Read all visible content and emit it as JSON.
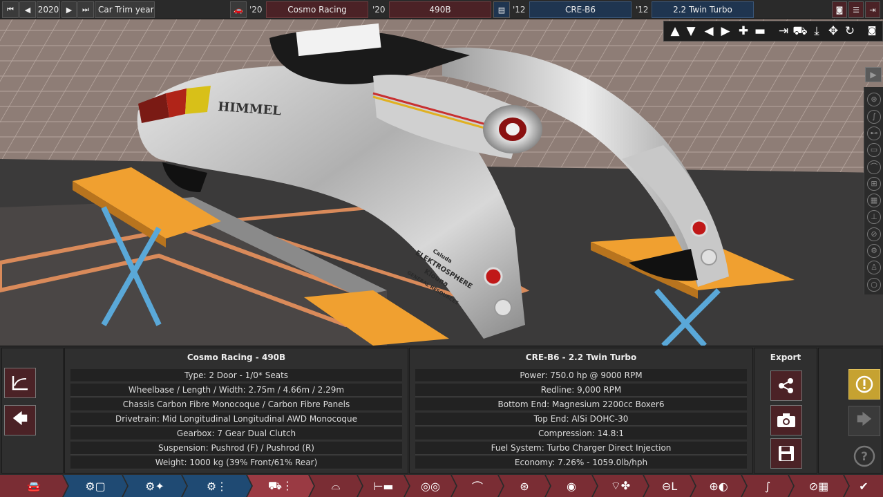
{
  "topbar": {
    "year": "2020",
    "trim_label": "Car Trim year",
    "model_year_prefix": "'20",
    "make_name": "Cosmo Racing",
    "model_year_prefix_2": "'20",
    "model_name": "490B",
    "engine_year_prefix": "'12",
    "engine_family": "CRE-B6",
    "engine_year_prefix_2": "'12",
    "engine_variant": "2.2 Twin Turbo"
  },
  "car_panel": {
    "title": "Cosmo Racing - 490B",
    "rows": [
      "Type: 2 Door - 1/0* Seats",
      "Wheelbase / Length / Width: 2.75m / 4.66m / 2.29m",
      "Chassis Carbon Fibre Monocoque / Carbon Fibre Panels",
      "Drivetrain: Mid Longitudinal Longitudinal AWD Monocoque",
      "Gearbox: 7 Gear Dual Clutch",
      "Suspension: Pushrod (F) / Pushrod (R)",
      "Weight: 1000 kg (39% Front/61% Rear)"
    ]
  },
  "engine_panel": {
    "title": "CRE-B6 - 2.2 Twin Turbo",
    "rows": [
      "Power: 750.0 hp @ 9000 RPM",
      "Redline:  9,000 RPM",
      "Bottom End: Magnesium 2200cc Boxer6",
      "Top End: AlSi DOHC-30",
      "Compression: 14.8:1",
      "Fuel System: Turbo Charger Direct Injection",
      "Economy: 7.26% - 1059.0lb/hph"
    ]
  },
  "export_panel": {
    "title": "Export"
  },
  "scene_text": {
    "brand": "HIMMEL",
    "sticker_1": "Caluda",
    "sticker_2": "ELEKTROSPHERE",
    "sticker_3": "Klouna",
    "sticker_4": "GENERAL RESOURCES"
  },
  "colors": {
    "accent_red": "#7a2d34",
    "accent_blue": "#1f4a73",
    "warning_yellow": "#c6a231",
    "lift_orange": "#f0a030",
    "lift_blue": "#5aa8d8"
  }
}
